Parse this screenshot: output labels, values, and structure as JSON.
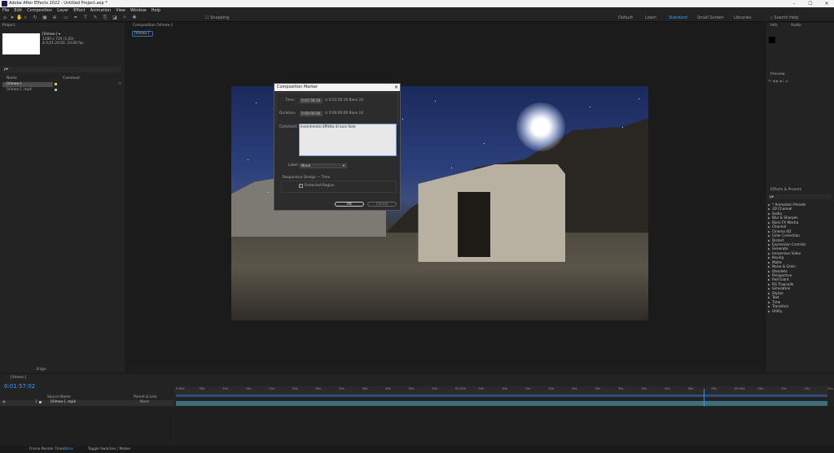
{
  "window": {
    "title": "Adobe After Effects 2022 - Untitled Project.aep *",
    "controls": [
      "–",
      "☐",
      "✕"
    ]
  },
  "menu": [
    "File",
    "Edit",
    "Composition",
    "Layer",
    "Effect",
    "Animation",
    "View",
    "Window",
    "Help"
  ],
  "workspaces": {
    "items": [
      "Default",
      "Learn",
      "Standard",
      "Small Screen",
      "Libraries"
    ],
    "active": "Standard",
    "search_placeholder": "Search Help"
  },
  "toolbar": {
    "snapping_label": "Snapping"
  },
  "project_panel": {
    "tab": "Project",
    "item_name": "[Vimeo-] ▾",
    "item_info_1": "1280 x 720 (1,00)",
    "item_info_2": "Δ 0;01:24;02, 24,00 fps",
    "search_placeholder": "ρ▾",
    "columns": [
      "Name",
      "Comment"
    ],
    "rows": [
      {
        "name": "[Vimeo-]",
        "type": "composition"
      },
      {
        "name": "[Vimeo-] .mp4",
        "type": "footage"
      }
    ],
    "bpc_label": "8 bpc"
  },
  "composition_panel": {
    "tab": "Composition [Vimeo-]",
    "sub_tab": "[Vimeo-]"
  },
  "dialog": {
    "title": "Composition Marker",
    "time_label": "Time:",
    "time_value": "0:01:56:19",
    "time_suffix": "is 0:01:56:19  Base 24",
    "duration_label": "Duration:",
    "duration_value": "0:00:00:00",
    "duration_suffix": "is 0:00:00:00  Base 24",
    "comment_label": "Comment:",
    "comment_value": "Inserimento Effetto di luce Sole",
    "label_label": "Label:",
    "label_value": "None",
    "section": "Responsive Design — Time",
    "protected_region": "Protected Region",
    "ok": "OK",
    "cancel": "Cancel"
  },
  "right_panel": {
    "info_tab": "Info",
    "audio_tab": "Audio",
    "preview_tab": "Preview",
    "effects_tab": "Effects & Presets",
    "effects_search_placeholder": "ρ▾",
    "effects": [
      "* Animation Presets",
      "3D Channel",
      "Audio",
      "Blur & Sharpen",
      "Boris FX Mocha",
      "Channel",
      "Cinema 4D",
      "Color Correction",
      "Distort",
      "Expression Controls",
      "Generate",
      "Immersive Video",
      "Keying",
      "Matte",
      "Noise & Grain",
      "Obsolete",
      "Perspective",
      "Red Giant",
      "RG Trapcode",
      "Simulation",
      "Stylize",
      "Text",
      "Time",
      "Transition",
      "Utility"
    ]
  },
  "timeline": {
    "tab": "[Vimeo-]",
    "current_time": "0:01:57:02",
    "columns": [
      "Source Name",
      "Parent & Link"
    ],
    "layer_index": "1",
    "layer_name": "[Vimeo-] .mp4",
    "layer_parent": "None",
    "ruler_labels": [
      "0:00s",
      "05s",
      "10s",
      "15s",
      "20s",
      "25s",
      "30s",
      "35s",
      "40s",
      "45s",
      "50s",
      "55s",
      "01:00s",
      "05s",
      "10s",
      "15s",
      "20s",
      "25s",
      "30s",
      "35s",
      "40s",
      "45s",
      "50s",
      "55s",
      "02:00s",
      "05s",
      "10s",
      "15s",
      "20s"
    ],
    "playhead_fraction": 0.81,
    "colors": {
      "playhead": "#3a8ee6",
      "work_area": "#2f4e77",
      "layer_bar": "#3e6e7c",
      "accent": "#3aa0ff"
    }
  },
  "status_bar": {
    "render_label": "Frame Render Time:",
    "render_value": "84ms",
    "toggle": "Toggle Switches / Modes"
  }
}
